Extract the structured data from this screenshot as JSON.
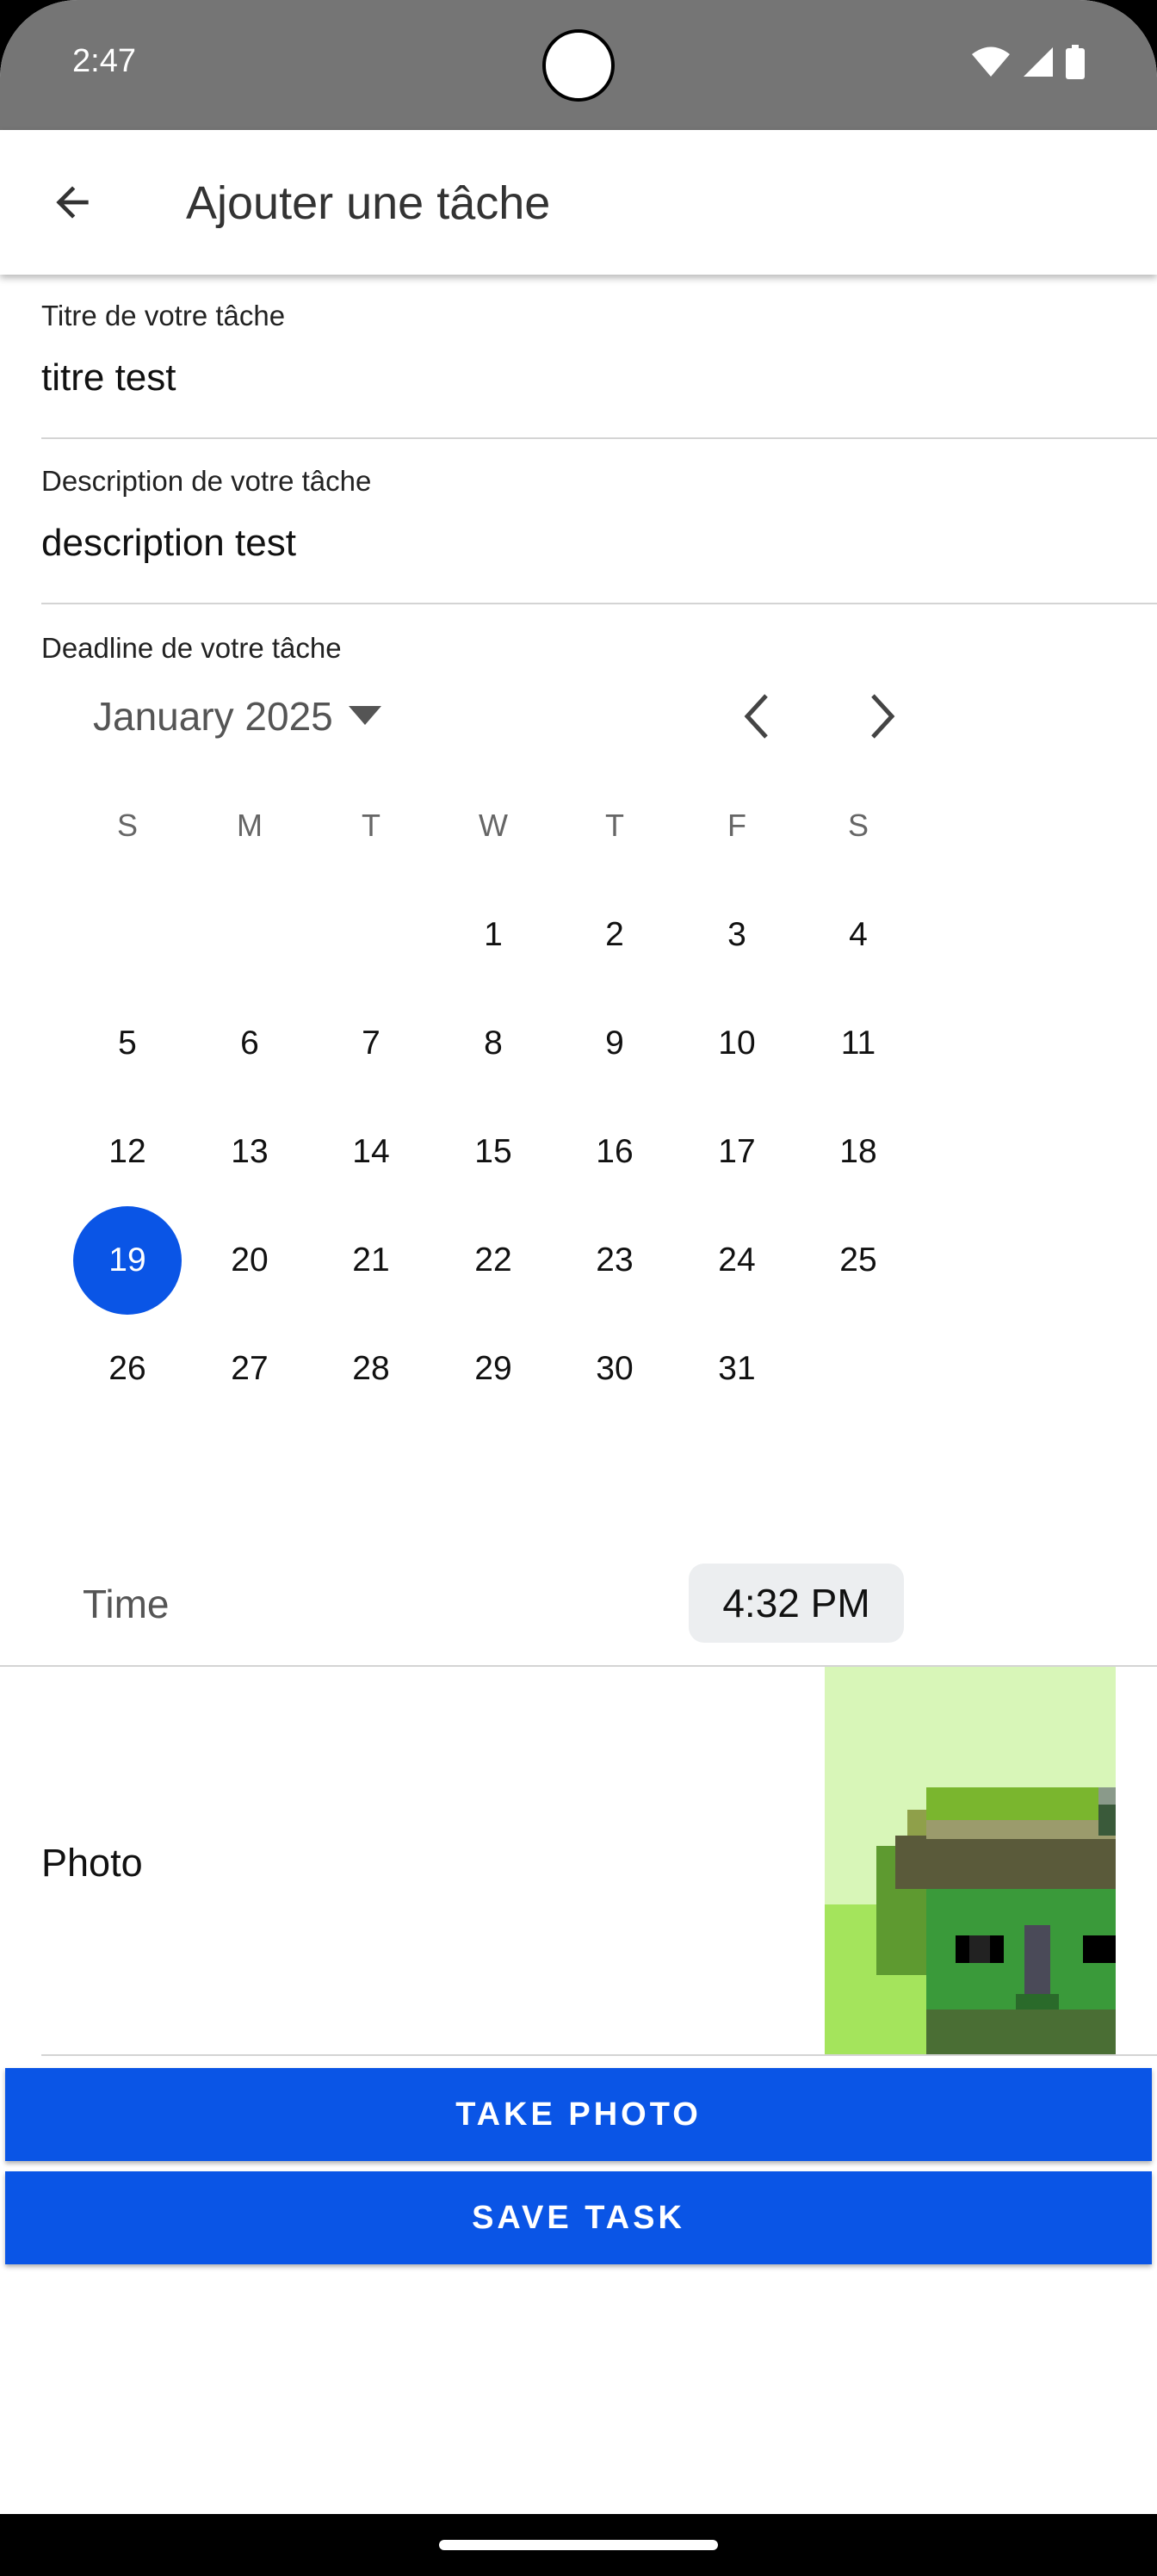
{
  "status_bar": {
    "time": "2:47"
  },
  "app_bar": {
    "title": "Ajouter une tâche"
  },
  "form": {
    "title_label": "Titre de votre tâche",
    "title_value": "titre test",
    "description_label": "Description de votre tâche",
    "description_value": "description test",
    "deadline_label": "Deadline de votre tâche"
  },
  "calendar": {
    "month_label": "January 2025",
    "weekdays": [
      "S",
      "M",
      "T",
      "W",
      "T",
      "F",
      "S"
    ],
    "first_weekday_index": 3,
    "days_in_month": 31,
    "selected_day": 19
  },
  "time": {
    "label": "Time",
    "value": "4:32 PM"
  },
  "photo": {
    "label": "Photo"
  },
  "buttons": {
    "take_photo": "TAKE PHOTO",
    "save_task": "SAVE TASK"
  },
  "colors": {
    "accent": "#0a55e6",
    "status_bar": "#757575"
  },
  "icons": {
    "back": "arrow-left-icon",
    "dropdown": "caret-down-icon",
    "prev": "chevron-left-icon",
    "next": "chevron-right-icon",
    "wifi": "wifi-icon",
    "signal": "signal-icon",
    "battery": "battery-icon"
  }
}
